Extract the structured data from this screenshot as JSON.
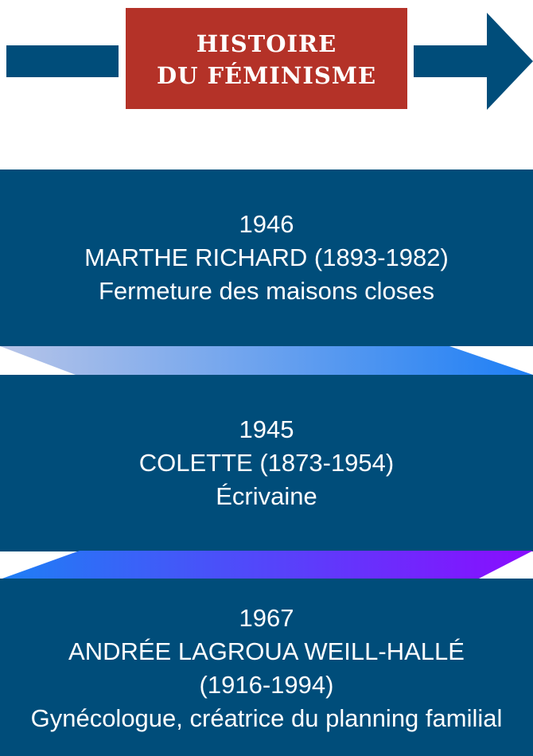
{
  "header": {
    "title_line1": "HISTOIRE",
    "title_line2": "DU FÉMINISME"
  },
  "colors": {
    "navy": "#004d7a",
    "title_red": "#b43228",
    "connector1_start": "#b6c4e8",
    "connector1_end": "#1e7ff5",
    "connector2_start": "#1e7ff5",
    "connector2_end": "#8a0cff"
  },
  "timeline": [
    {
      "year": "1946",
      "person": "MARTHE RICHARD (1893-1982)",
      "detail": "Fermeture des maisons closes"
    },
    {
      "year": "1945",
      "person": "COLETTE (1873-1954)",
      "detail": "Écrivaine"
    },
    {
      "year": "1967",
      "person": "ANDRÉE LAGROUA WEILL-HALLÉ",
      "dates": "(1916-1994)",
      "detail": "Gynécologue, créatrice du planning familial"
    }
  ]
}
